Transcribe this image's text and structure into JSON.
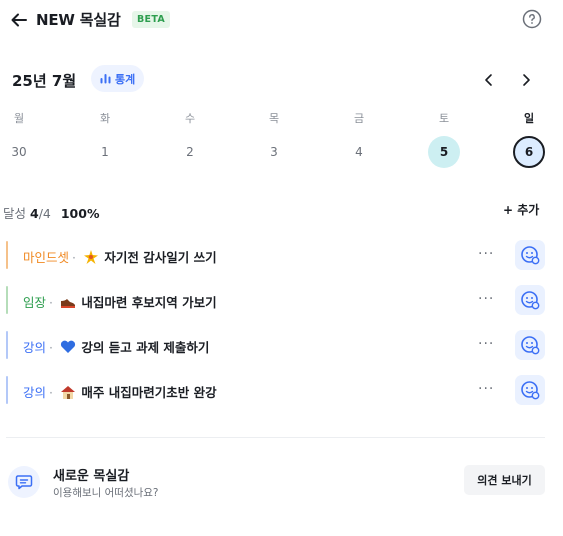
{
  "header": {
    "title": "NEW 목실감",
    "badge": "BETA",
    "back_icon": "arrow-left-icon",
    "help_icon": "help-circle-icon"
  },
  "calendar": {
    "month_title": "25년 7월",
    "stats_label": "통계",
    "weekdays": [
      "월",
      "화",
      "수",
      "목",
      "금",
      "토",
      "일"
    ],
    "dates": [
      "30",
      "1",
      "2",
      "3",
      "4",
      "5",
      "6"
    ],
    "highlight_saturday": "5",
    "today": "6"
  },
  "summary": {
    "label": "달성",
    "done": "4",
    "total": "/4",
    "percent": "100%",
    "add_label": "+ 추가"
  },
  "tasks": [
    {
      "category": "마인드셋",
      "title": "자기전 감사일기 쓰기",
      "color": "#f08a24",
      "emoji": "sparkle-icon",
      "more": "···"
    },
    {
      "category": "임장",
      "title": "내집마련 후보지역 가보기",
      "color": "#2e9e4f",
      "emoji": "shoe-icon",
      "more": "···"
    },
    {
      "category": "강의",
      "title": "강의 듣고 과제 제출하기",
      "color": "#3b6ff5",
      "emoji": "blue-heart-icon",
      "more": "···"
    },
    {
      "category": "강의",
      "title": "매주 내집마련기초반 완강",
      "color": "#3b6ff5",
      "emoji": "house-icon",
      "more": "···"
    }
  ],
  "feedback": {
    "title": "새로운 목실감",
    "subtitle": "이용해보니 어떠셨나요?",
    "button": "의견 보내기"
  },
  "colors": {
    "accent": "#3b6ff5",
    "saturday_bg": "#cdeff2",
    "beta_bg": "#e6f6e9",
    "beta_text": "#2e9e4f"
  }
}
